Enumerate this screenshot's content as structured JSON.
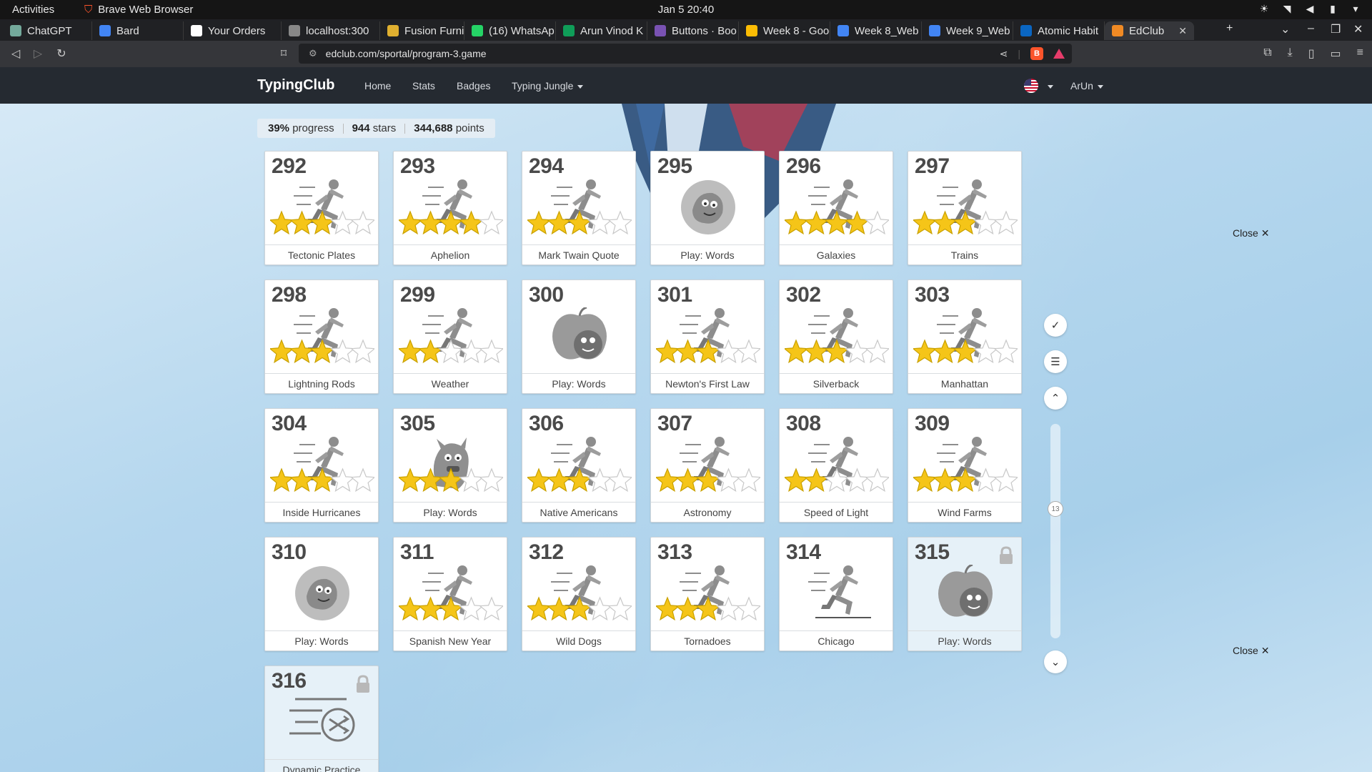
{
  "topbar": {
    "activities": "Activities",
    "app_name": "Brave Web Browser",
    "clock": "Jan 5  20:40"
  },
  "tabs": [
    {
      "title": "ChatGPT",
      "icon": "chatgpt-icon",
      "color": "#74aa9c"
    },
    {
      "title": "Bard",
      "icon": "bard-icon",
      "color": "#4285f4"
    },
    {
      "title": "Your Orders",
      "icon": "amazon-icon",
      "color": "#ffffff"
    },
    {
      "title": "localhost:300",
      "icon": "globe-icon",
      "color": "#888888"
    },
    {
      "title": "Fusion Furni",
      "icon": "fusion-icon",
      "color": "#e0b030"
    },
    {
      "title": "(16) WhatsAp",
      "icon": "whatsapp-icon",
      "color": "#25d366"
    },
    {
      "title": "Arun Vinod K",
      "icon": "sheets-icon",
      "color": "#0f9d58"
    },
    {
      "title": "Buttons · Boo",
      "icon": "bootstrap-icon",
      "color": "#7952b3"
    },
    {
      "title": "Week 8 - Goog",
      "icon": "drive-icon",
      "color": "#fbbc04"
    },
    {
      "title": "Week 8_Web",
      "icon": "docs-icon",
      "color": "#4285f4"
    },
    {
      "title": "Week 9_Web",
      "icon": "docs-icon",
      "color": "#4285f4"
    },
    {
      "title": "Atomic Habit",
      "icon": "linkedin-icon",
      "color": "#0a66c2"
    },
    {
      "title": "EdClub",
      "icon": "edclub-icon",
      "color": "#f08a24",
      "active": true
    }
  ],
  "url": "edclub.com/sportal/program-3.game",
  "site": {
    "brand": "TypingClub",
    "nav": [
      "Home",
      "Stats",
      "Badges",
      "Typing Jungle"
    ],
    "user": "ArUn"
  },
  "summary": {
    "progress_value": "39%",
    "progress_label": "progress",
    "stars_value": "944",
    "stars_label": "stars",
    "points_value": "344,688",
    "points_label": "points"
  },
  "side": {
    "close_label": "Close",
    "close_symbol": "✕",
    "scroll_marker": "13"
  },
  "lessons": [
    {
      "num": "292",
      "label": "Tectonic Plates",
      "kind": "runner",
      "stars": 3
    },
    {
      "num": "293",
      "label": "Aphelion",
      "kind": "runner",
      "stars": 4
    },
    {
      "num": "294",
      "label": "Mark Twain Quote",
      "kind": "runner",
      "stars": 3
    },
    {
      "num": "295",
      "label": "Play: Words",
      "kind": "game-blob",
      "stars": 0
    },
    {
      "num": "296",
      "label": "Galaxies",
      "kind": "runner",
      "stars": 4
    },
    {
      "num": "297",
      "label": "Trains",
      "kind": "runner",
      "stars": 3
    },
    {
      "num": "298",
      "label": "Lightning Rods",
      "kind": "runner",
      "stars": 3
    },
    {
      "num": "299",
      "label": "Weather",
      "kind": "runner",
      "stars": 2
    },
    {
      "num": "300",
      "label": "Play: Words",
      "kind": "game-apple",
      "stars": 0
    },
    {
      "num": "301",
      "label": "Newton's First Law",
      "kind": "runner",
      "stars": 3
    },
    {
      "num": "302",
      "label": "Silverback",
      "kind": "runner",
      "stars": 3
    },
    {
      "num": "303",
      "label": "Manhattan",
      "kind": "runner",
      "stars": 3
    },
    {
      "num": "304",
      "label": "Inside Hurricanes",
      "kind": "runner",
      "stars": 3
    },
    {
      "num": "305",
      "label": "Play: Words",
      "kind": "game-monster",
      "stars": 3
    },
    {
      "num": "306",
      "label": "Native Americans",
      "kind": "runner",
      "stars": 3
    },
    {
      "num": "307",
      "label": "Astronomy",
      "kind": "runner",
      "stars": 3
    },
    {
      "num": "308",
      "label": "Speed of Light",
      "kind": "runner",
      "stars": 2
    },
    {
      "num": "309",
      "label": "Wind Farms",
      "kind": "runner",
      "stars": 3
    },
    {
      "num": "310",
      "label": "Play: Words",
      "kind": "game-blob",
      "stars": 0
    },
    {
      "num": "311",
      "label": "Spanish New Year",
      "kind": "runner",
      "stars": 3
    },
    {
      "num": "312",
      "label": "Wild Dogs",
      "kind": "runner",
      "stars": 3
    },
    {
      "num": "313",
      "label": "Tornadoes",
      "kind": "runner",
      "stars": 3
    },
    {
      "num": "314",
      "label": "Chicago",
      "kind": "runner-line",
      "stars": 0
    },
    {
      "num": "315",
      "label": "Play: Words",
      "kind": "game-apple",
      "stars": 0,
      "locked": true
    },
    {
      "num": "316",
      "label": "Dynamic Practice",
      "kind": "shuffle",
      "stars": 0,
      "locked": true
    }
  ],
  "colors": {
    "star_gold": "#f5c518",
    "star_outline": "#c9a100",
    "art_gray": "#8d8d8d",
    "nav_bg": "#252a31"
  }
}
